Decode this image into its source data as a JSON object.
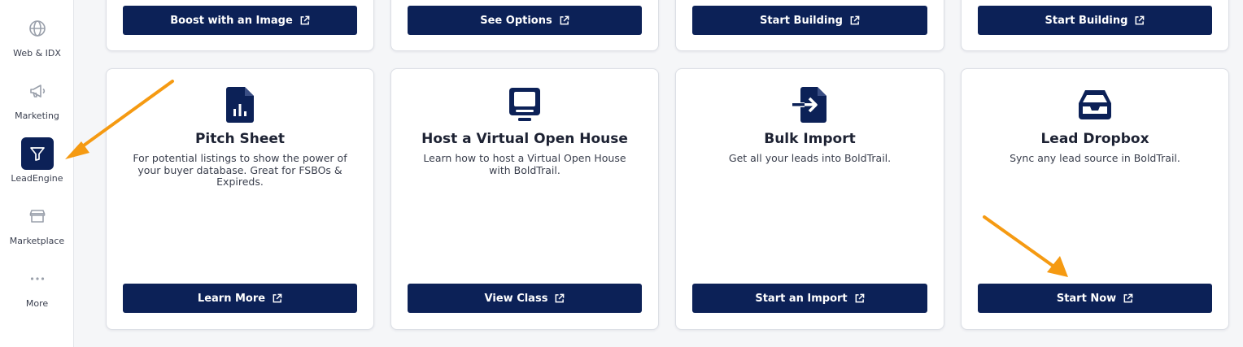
{
  "sidebar": {
    "items": [
      {
        "label": "Web & IDX",
        "icon": "globe-icon",
        "active": false
      },
      {
        "label": "Marketing",
        "icon": "megaphone-icon",
        "active": false
      },
      {
        "label": "LeadEngine",
        "icon": "funnel-icon",
        "active": true
      },
      {
        "label": "Marketplace",
        "icon": "storefront-icon",
        "active": false
      },
      {
        "label": "More",
        "icon": "more-dots-icon",
        "active": false
      }
    ]
  },
  "top_row": {
    "buttons": [
      "Boost with an Image",
      "See Options",
      "Start Building",
      "Start Building"
    ]
  },
  "cards": [
    {
      "icon": "report-chart-icon",
      "title": "Pitch Sheet",
      "description": "For potential listings to show the power of your buyer database. Great for FSBOs & Expireds.",
      "button": "Learn More"
    },
    {
      "icon": "monitor-icon",
      "title": "Host a Virtual Open House",
      "description": "Learn how to host a Virtual Open House with BoldTrail.",
      "button": "View Class"
    },
    {
      "icon": "file-import-icon",
      "title": "Bulk Import",
      "description": "Get all your leads into BoldTrail.",
      "button": "Start an Import"
    },
    {
      "icon": "inbox-tray-icon",
      "title": "Lead Dropbox",
      "description": "Sync any lead source in BoldTrail.",
      "button": "Start Now"
    }
  ],
  "colors": {
    "brand_navy": "#0c2157",
    "annotation_orange": "#f59a12"
  }
}
